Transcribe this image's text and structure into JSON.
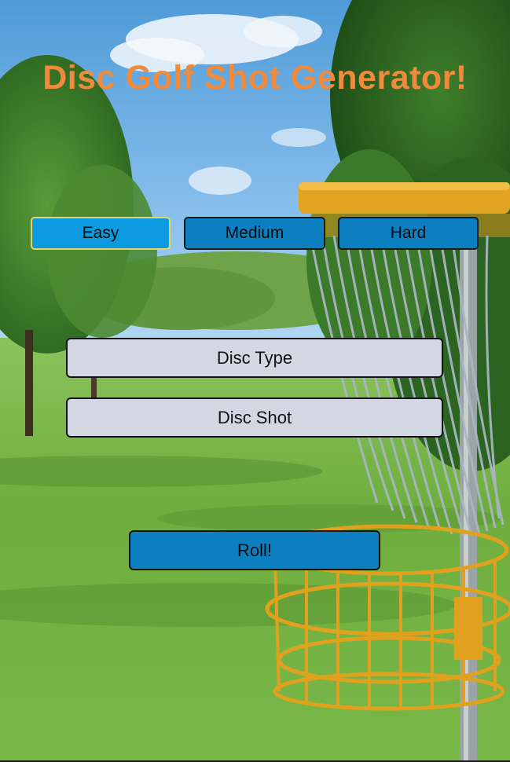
{
  "header": {
    "title": "Disc Golf Shot Generator!"
  },
  "difficulty": {
    "selected": "Easy",
    "options": [
      {
        "label": "Easy"
      },
      {
        "label": "Medium"
      },
      {
        "label": "Hard"
      }
    ]
  },
  "results": {
    "disc_type": "Disc Type",
    "disc_shot": "Disc Shot"
  },
  "actions": {
    "roll_label": "Roll!"
  },
  "colors": {
    "title": "#f08a3c",
    "button": "#0b7fc0",
    "button_active": "#0c9ae0",
    "field": "#d3d7e2",
    "basket": "#e0a21e"
  }
}
